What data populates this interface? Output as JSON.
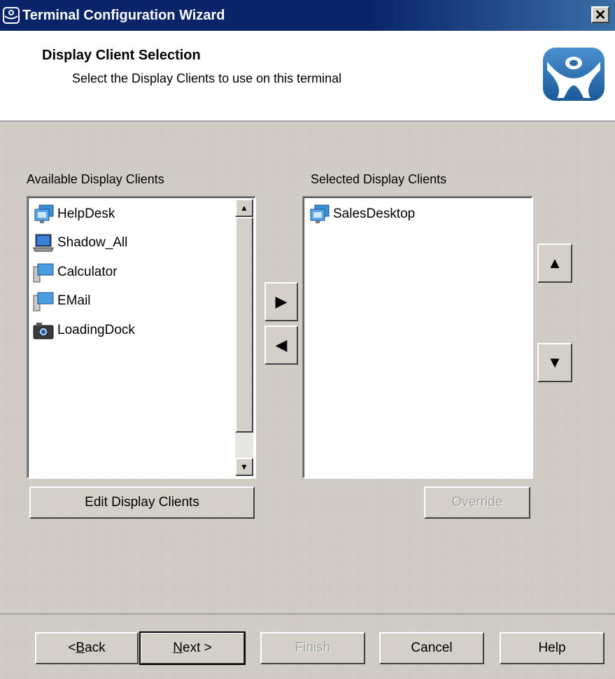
{
  "window": {
    "title": "Terminal Configuration Wizard",
    "close_glyph": "✕"
  },
  "header": {
    "title": "Display Client Selection",
    "subtitle": "Select the Display Clients to use on this terminal",
    "logo_icon": "thinmanager-logo-icon"
  },
  "available": {
    "label": "Available Display Clients",
    "items": [
      {
        "label": "HelpDesk",
        "icon": "terminal-services-icon"
      },
      {
        "label": "Shadow_All",
        "icon": "laptop-shadow-icon"
      },
      {
        "label": "Calculator",
        "icon": "app-server-icon"
      },
      {
        "label": "EMail",
        "icon": "app-server-icon"
      },
      {
        "label": "LoadingDock",
        "icon": "camera-icon"
      }
    ],
    "edit_button": "Edit Display Clients"
  },
  "selected": {
    "label": "Selected Display Clients",
    "items": [
      {
        "label": "SalesDesktop",
        "icon": "terminal-services-icon"
      }
    ],
    "override_button": "Override"
  },
  "move": {
    "add_glyph": "▶",
    "remove_glyph": "◀",
    "up_glyph": "▲",
    "down_glyph": "▼"
  },
  "footer": {
    "back_pre": "< ",
    "back_accel": "B",
    "back_post": "ack",
    "next_accel": "N",
    "next_post": "ext >",
    "finish": "Finish",
    "cancel": "Cancel",
    "help": "Help"
  },
  "colors": {
    "titlebar": "#0a246a",
    "face": "#d4d0c8",
    "logo_blue": "#2a6ea8"
  }
}
